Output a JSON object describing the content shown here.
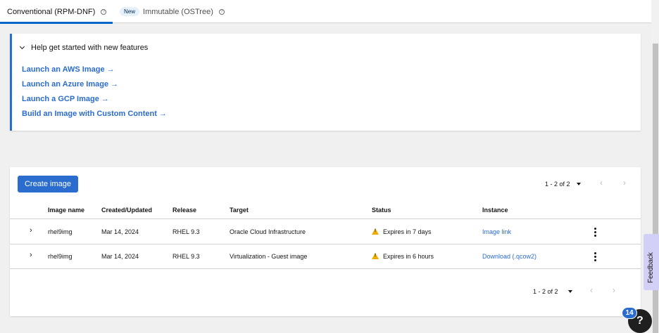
{
  "tabs": {
    "conventional": "Conventional (RPM-DNF)",
    "new_badge": "New",
    "immutable": "Immutable (OSTree)",
    "help_glyph": "?"
  },
  "help": {
    "title": "Help get started with new features",
    "links": [
      "Launch an AWS Image",
      "Launch an Azure Image",
      "Launch a GCP Image",
      "Build an Image with Custom Content"
    ],
    "arrow": "→"
  },
  "toolbar": {
    "create_label": "Create image",
    "pagination_top": "1 - 2 of 2",
    "pagination_bottom": "1 - 2 of 2",
    "prev_glyph": "‹",
    "next_glyph": "›"
  },
  "table": {
    "headers": [
      "Image name",
      "Created/Updated",
      "Release",
      "Target",
      "Status",
      "Instance"
    ],
    "rows": [
      {
        "name": "rhel9img",
        "created": "Mar 14, 2024",
        "release": "RHEL 9.3",
        "target": "Oracle Cloud Infrastructure",
        "status": "Expires in 7 days",
        "instance": "Image link"
      },
      {
        "name": "rhel9img",
        "created": "Mar 14, 2024",
        "release": "RHEL 9.3",
        "target": "Virtualization - Guest image",
        "status": "Expires in 6 hours",
        "instance": "Download (.qcow2)"
      }
    ],
    "expand_glyph": "›"
  },
  "feedback": {
    "label": "Feedback"
  },
  "help_fab": {
    "badge": "14",
    "glyph": "?"
  },
  "colors": {
    "accent": "#2b6ccf",
    "warning": "#f0ab00",
    "feedback_bg": "#d3d0f7"
  },
  "icons": [
    "help-circle-icon",
    "chevron-down-icon",
    "arrow-right-icon",
    "caret-down-icon",
    "angle-left-icon",
    "angle-right-icon",
    "warning-triangle-icon",
    "kebab-icon",
    "feedback-icon",
    "question-icon"
  ]
}
